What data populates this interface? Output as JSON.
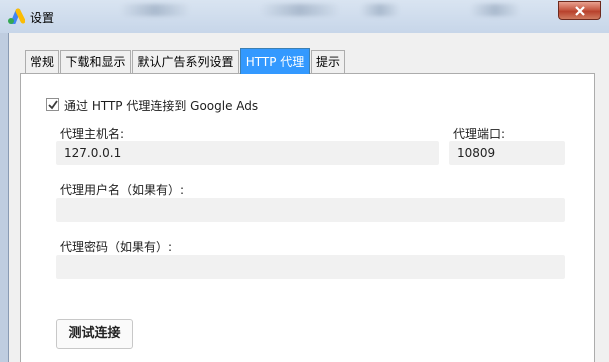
{
  "window": {
    "title": "设置"
  },
  "tabs": [
    {
      "label": "常规"
    },
    {
      "label": "下载和显示"
    },
    {
      "label": "默认广告系列设置"
    },
    {
      "label": "HTTP 代理",
      "selected": true
    },
    {
      "label": "提示"
    }
  ],
  "proxy": {
    "use_proxy_label": "通过 HTTP 代理连接到 Google Ads",
    "use_proxy_checked": true,
    "host_label": "代理主机名:",
    "host_value": "127.0.0.1",
    "port_label": "代理端口:",
    "port_value": "10809",
    "username_label": "代理用户名（如果有）:",
    "username_value": "",
    "password_label": "代理密码（如果有）:",
    "password_value": "",
    "test_button": "测试连接"
  },
  "colors": {
    "tab_selected": "#3399ff",
    "close_button": "#c75a45",
    "field_bg": "#f1f1f1"
  }
}
